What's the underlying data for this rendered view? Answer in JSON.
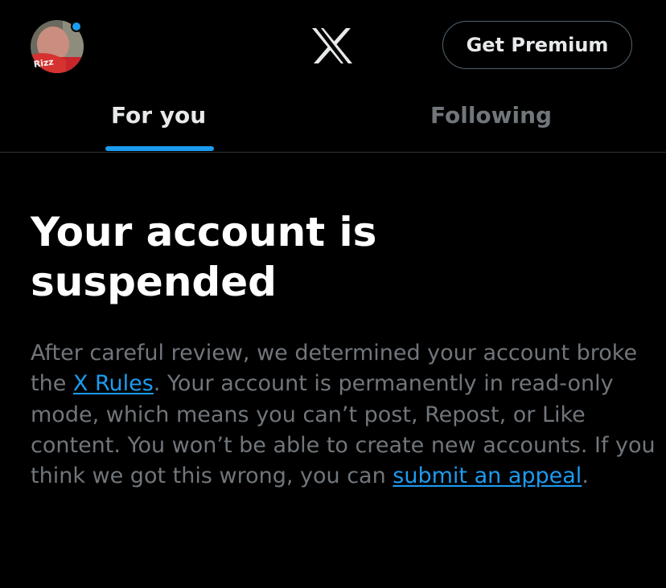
{
  "header": {
    "logo_icon": "x-logo-icon",
    "avatar_icon": "profile-avatar",
    "avatar_text": "Rizz",
    "premium_label": "Get Premium"
  },
  "tabs": [
    {
      "label": "For you",
      "active": true
    },
    {
      "label": "Following",
      "active": false
    }
  ],
  "notice": {
    "title_line1": "Your account is",
    "title_line2": "suspended",
    "body": {
      "t1": "After careful review, we determined your account broke the ",
      "link1": "X Rules",
      "t2": ". Your account is permanently in read-only mode, which means you can’t post, Repost, or Like content. You won’t be able to create new accounts. If you think we got this wrong, you can ",
      "link2": "submit an appeal",
      "t3": "."
    }
  },
  "colors": {
    "background": "#000000",
    "accent": "#1d9bf0",
    "text_primary": "#e7e9ea",
    "text_secondary": "#71767b",
    "border": "#2f3336"
  }
}
